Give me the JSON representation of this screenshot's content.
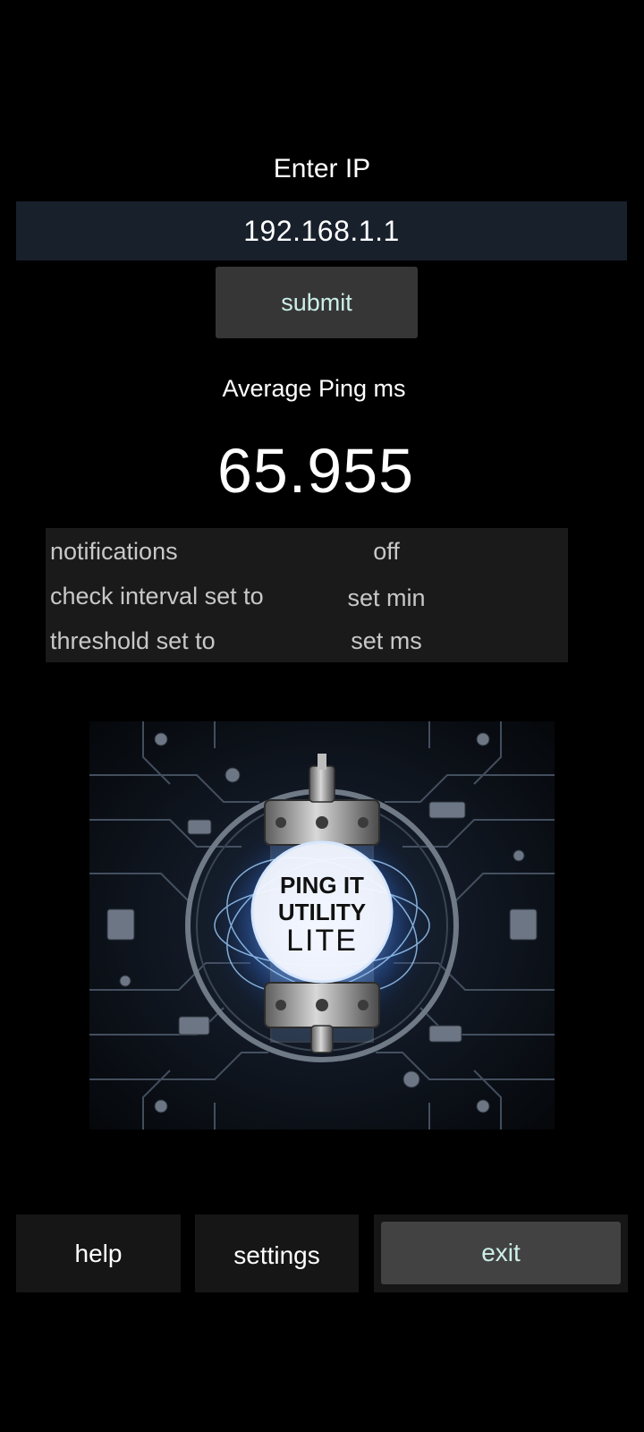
{
  "ip": {
    "label": "Enter IP",
    "value": "192.168.1.1",
    "submit_label": "submit"
  },
  "ping": {
    "label": "Average Ping ms",
    "value": "65.955"
  },
  "settings": {
    "rows": [
      {
        "key": "notifications",
        "value": "off"
      },
      {
        "key": "check interval set to",
        "value": "set min"
      },
      {
        "key": "threshold set to",
        "value": "set ms"
      }
    ]
  },
  "logo": {
    "line1": "PING IT",
    "line2": "UTILITY",
    "line3": "LITE"
  },
  "buttons": {
    "help": "help",
    "settings": "settings",
    "exit": "exit"
  },
  "colors": {
    "background": "#000000",
    "input_bg": "#18202c",
    "button_bg": "#363636",
    "button_text": "#ccefe8",
    "panel_bg": "#1a1a1a"
  }
}
